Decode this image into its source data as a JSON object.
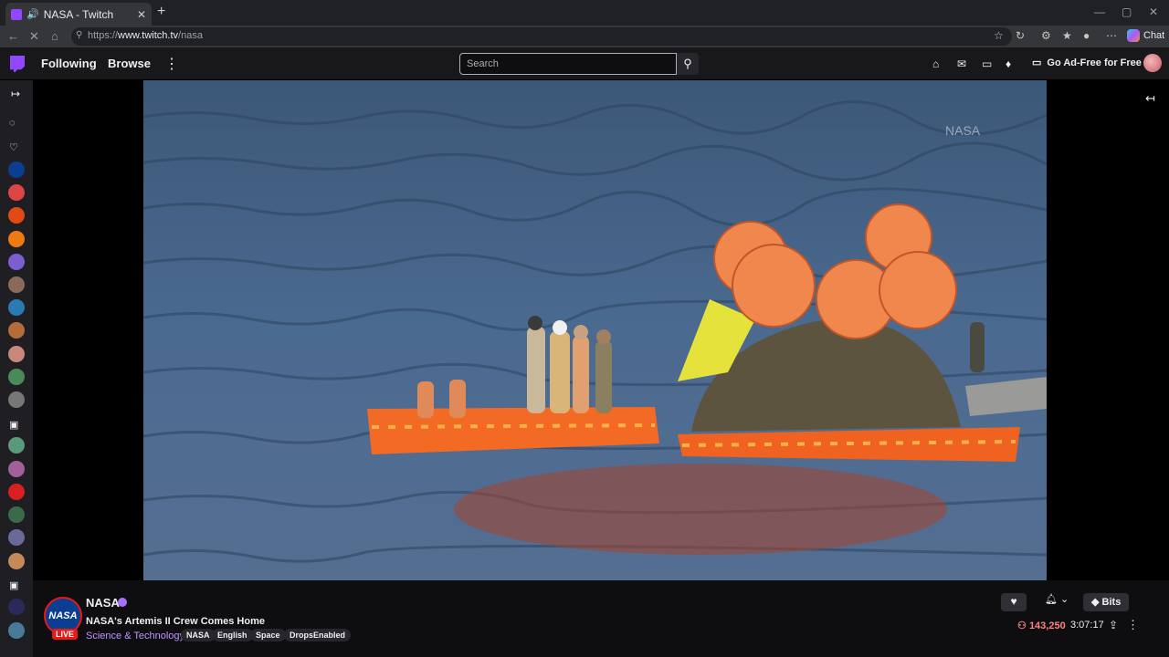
{
  "browser": {
    "tab_title": "NASA - Twitch",
    "url_scheme": "https://",
    "url_host": "www.twitch.tv",
    "url_path": "/nasa",
    "chat_label": "Chat"
  },
  "header": {
    "following": "Following",
    "browse": "Browse",
    "search_placeholder": "Search",
    "ad_free": "Go Ad-Free for Free"
  },
  "channel": {
    "name": "NASA",
    "avatar_text": "NASA",
    "live": "LIVE",
    "title": "NASA's Artemis II Crew Comes Home",
    "category": "Science & Technology",
    "tags": [
      "NASA",
      "English",
      "Space",
      "DropsEnabled"
    ],
    "viewers": "143,250",
    "uptime": "3:07:17",
    "bits": "Bits"
  },
  "video": {
    "watermark": "NASA"
  },
  "colors": {
    "twitch_purple": "#9146ff",
    "live_red": "#e91916",
    "viewer_red": "#ff8280",
    "category_purple": "#bf94ff"
  },
  "icons": [
    "twitch-logo-icon",
    "search-icon",
    "heart-icon",
    "bell-icon",
    "share-icon",
    "more-icon"
  ]
}
